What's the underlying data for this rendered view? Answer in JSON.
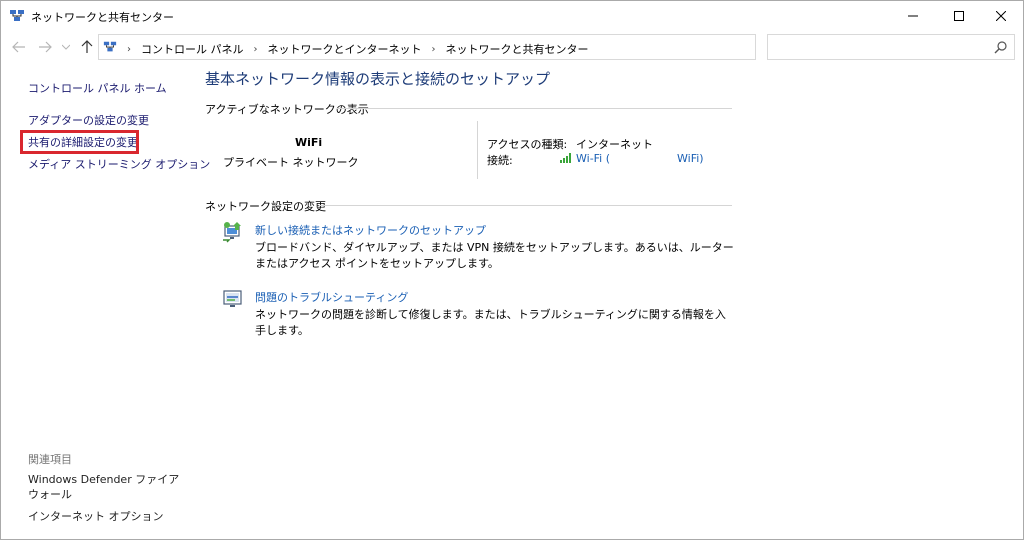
{
  "window": {
    "title": "ネットワークと共有センター"
  },
  "address": {
    "crumbs": [
      "コントロール パネル",
      "ネットワークとインターネット",
      "ネットワークと共有センター"
    ],
    "search_placeholder": ""
  },
  "left": {
    "home": "コントロール パネル ホーム",
    "adapter": "アダプターの設定の変更",
    "sharing": "共有の詳細設定の変更",
    "media": "メディア ストリーミング オプション",
    "related_title": "関連項目",
    "defender": "Windows Defender ファイアウォール",
    "internet_options": "インターネット オプション"
  },
  "main": {
    "title": "基本ネットワーク情報の表示と接続のセットアップ",
    "active_label": "アクティブなネットワークの表示",
    "network_name": "WiFi",
    "network_type": "プライベート ネットワーク",
    "access_label": "アクセスの種類:",
    "access_value": "インターネット",
    "connection_label": "接続:",
    "connection_link_a": "Wi-Fi (",
    "connection_link_b": "WiFi)",
    "change_label": "ネットワーク設定の変更",
    "task1_link": "新しい接続またはネットワークのセットアップ",
    "task1_desc": "ブロードバンド、ダイヤルアップ、または VPN 接続をセットアップします。あるいは、ルーターまたはアクセス ポイントをセットアップします。",
    "task2_link": "問題のトラブルシューティング",
    "task2_desc": "ネットワークの問題を診断して修復します。または、トラブルシューティングに関する情報を入手します。"
  },
  "colors": {
    "link": "#1a5fb4",
    "title": "#1e3c78",
    "highlight": "#d9272e"
  }
}
